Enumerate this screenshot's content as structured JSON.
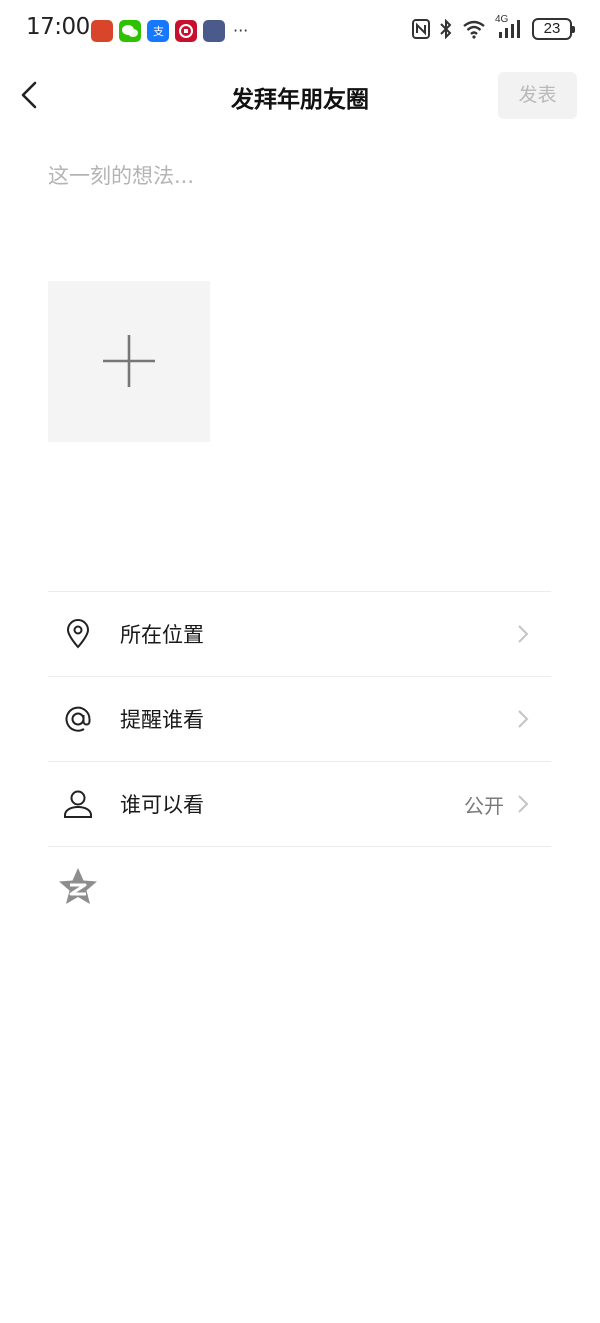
{
  "status_bar": {
    "time": "17:00",
    "more": "···",
    "network": "4G",
    "battery": "23",
    "notification_icons": [
      "game-app-icon",
      "wechat-icon",
      "alipay-icon",
      "bank-app-icon",
      "game-app-icon-2"
    ],
    "colors": {
      "game": "#d9452b",
      "wechat": "#2dc100",
      "alipay": "#1677ff",
      "bank": "#c8102e",
      "game2": "#4a5a8a"
    }
  },
  "header": {
    "title": "发拜年朋友圈",
    "publish_label": "发表"
  },
  "composer": {
    "placeholder": "这一刻的想法...",
    "value": ""
  },
  "options": [
    {
      "icon": "location-pin-icon",
      "label": "所在位置",
      "value": ""
    },
    {
      "icon": "at-mention-icon",
      "label": "提醒谁看",
      "value": ""
    },
    {
      "icon": "person-icon",
      "label": "谁可以看",
      "value": "公开"
    }
  ],
  "extra_icons": [
    "qzone-star-icon"
  ]
}
